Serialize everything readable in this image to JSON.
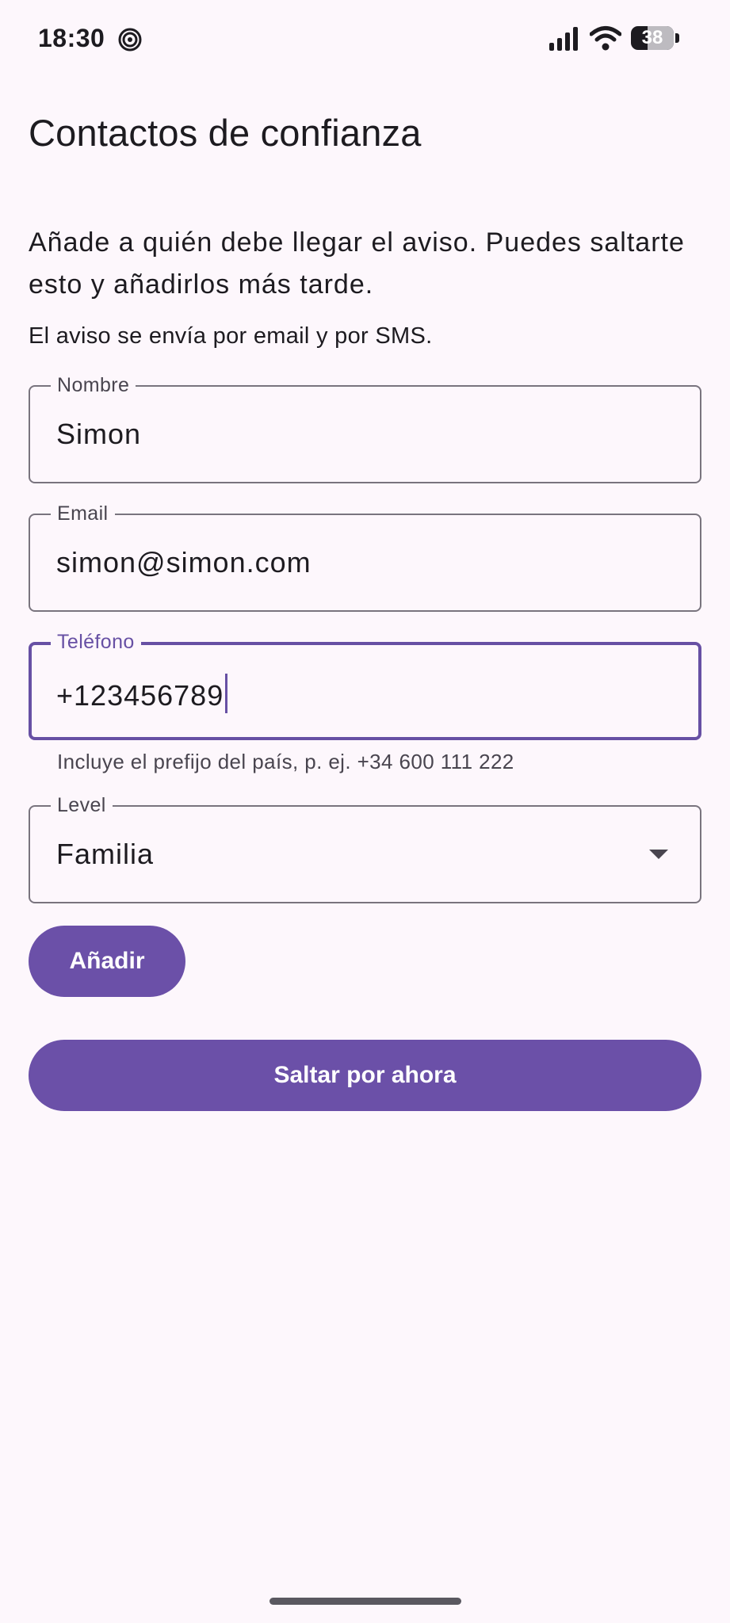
{
  "status_bar": {
    "time": "18:30",
    "battery_level": "38",
    "icons": [
      "spiral-icon",
      "signal-icon",
      "wifi-icon",
      "battery-icon"
    ]
  },
  "page": {
    "title": "Contactos de confianza",
    "intro": "Añade a quién debe llegar el aviso. Puedes saltarte esto y añadirlos más tarde.",
    "note": "El aviso se envía por email y por SMS."
  },
  "form": {
    "name": {
      "label": "Nombre",
      "value": "Simon"
    },
    "email": {
      "label": "Email",
      "value": "simon@simon.com"
    },
    "phone": {
      "label": "Teléfono",
      "value": "+123456789",
      "helper": "Incluye el prefijo del país, p. ej. +34 600 111 222"
    },
    "level": {
      "label": "Level",
      "value": "Familia"
    }
  },
  "actions": {
    "add_label": "Añadir",
    "skip_label": "Saltar por ahora"
  },
  "colors": {
    "accent": "#6750a4",
    "button": "#6b50a8",
    "background": "#fdf7fc",
    "outline": "#79747e"
  }
}
